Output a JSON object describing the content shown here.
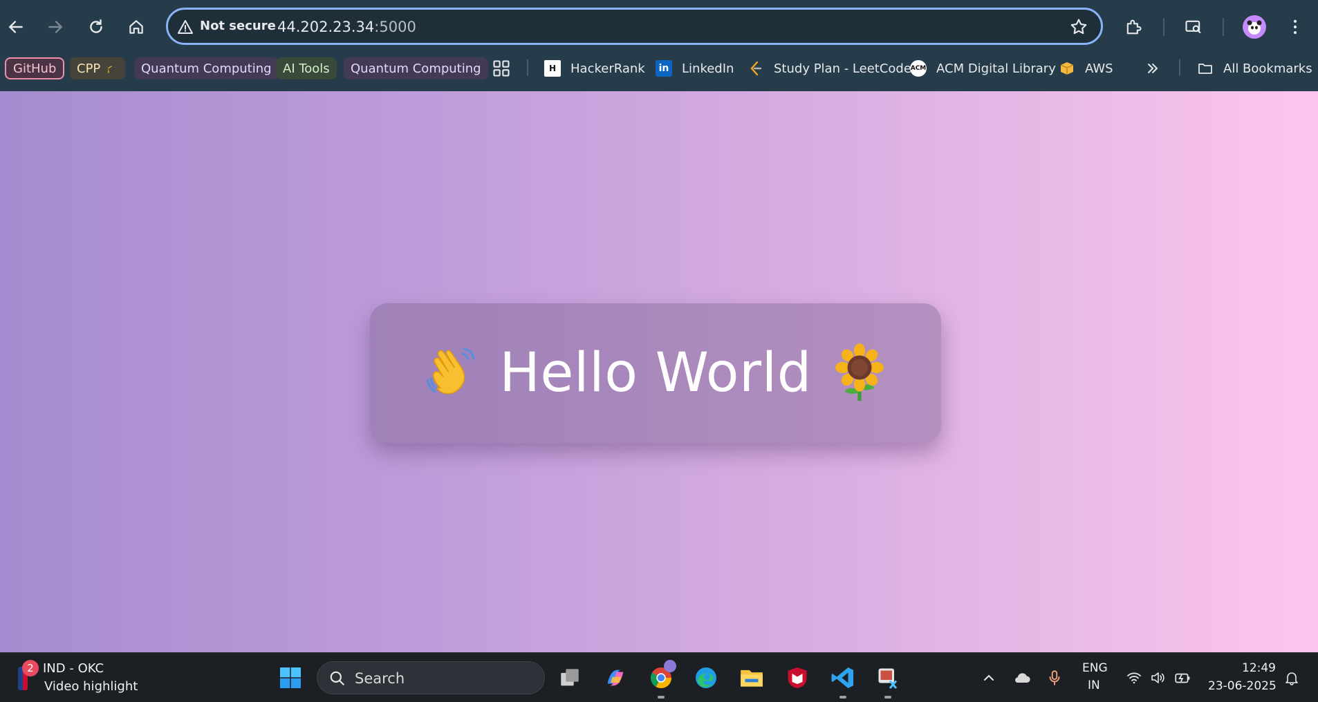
{
  "browser": {
    "security_label": "Not secure",
    "url_host": "44.202.23.34",
    "url_port": ":5000"
  },
  "bookmarks": {
    "github": "GitHub",
    "cpp": "CPP",
    "quantum1": "Quantum Computing",
    "ai_tools": "AI Tools",
    "quantum2": "Quantum Computing",
    "hackerrank": "HackerRank",
    "linkedin": "LinkedIn",
    "leetcode": "Study Plan - LeetCode",
    "acm": "ACM Digital Library",
    "aws": "AWS",
    "all_bookmarks": "All Bookmarks"
  },
  "page": {
    "greeting": "Hello World",
    "emoji_left": "waving-hand",
    "emoji_right": "sunflower",
    "gradient": [
      "#a58cd0",
      "#fdc5ee"
    ]
  },
  "taskbar": {
    "news_badge": "2",
    "news_title": "IND - OKC",
    "news_subtitle": "Video highlight",
    "search_label": "Search",
    "lang": "ENG",
    "region": "IN",
    "time": "12:49",
    "date": "23-06-2025"
  }
}
